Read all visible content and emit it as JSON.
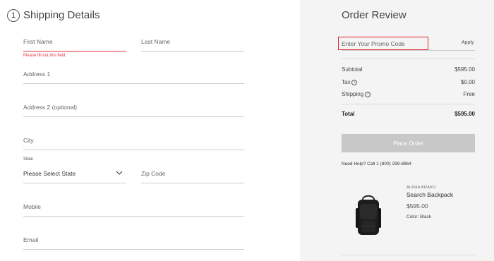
{
  "shipping": {
    "step_number": "1",
    "title": "Shipping Details",
    "first_name_placeholder": "First Name",
    "first_name_error": "Please fill out this field.",
    "last_name_placeholder": "Last Name",
    "address1_placeholder": "Address 1",
    "address2_placeholder": "Address 2 (optional)",
    "city_placeholder": "City",
    "state_label": "State",
    "state_value": "Please Select State",
    "zip_placeholder": "Zip Code",
    "mobile_placeholder": "Mobile",
    "email_placeholder": "Email"
  },
  "review": {
    "title": "Order Review",
    "promo_placeholder": "Enter Your Promo Code",
    "apply_label": "Apply",
    "subtotal_label": "Subtotal",
    "subtotal_value": "$595.00",
    "tax_label": "Tax",
    "tax_value": "$0.00",
    "shipping_label": "Shipping",
    "shipping_value": "Free",
    "total_label": "Total",
    "total_value": "$595.00",
    "place_order_label": "Place Order",
    "help_text": "Need Help? Call 1 (800) 299-8864",
    "product": {
      "brand": "ALPHA BRAVO",
      "name": "Search Backpack",
      "price": "$595.00",
      "color": "Color: Black"
    }
  },
  "colors": {
    "error": "#e8343a",
    "highlight": "#e0232e",
    "button_disabled": "#c8c8c8",
    "panel_bg": "#f4f4f4"
  }
}
